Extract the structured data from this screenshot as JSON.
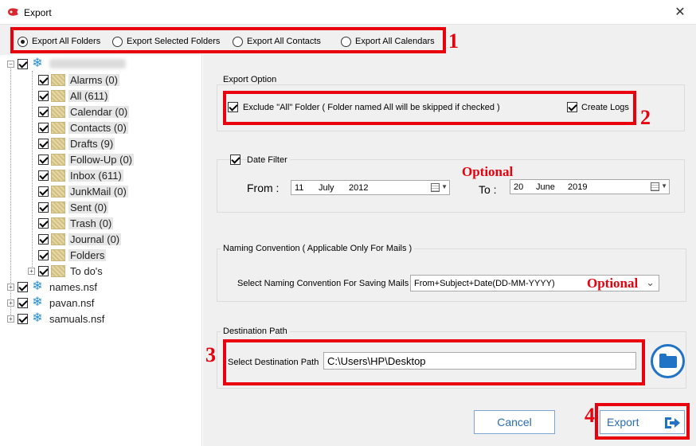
{
  "window": {
    "title": "Export",
    "close": "✕"
  },
  "radios": [
    {
      "label": "Export All Folders",
      "selected": true
    },
    {
      "label": "Export Selected Folders",
      "selected": false
    },
    {
      "label": "Export All Contacts",
      "selected": false
    },
    {
      "label": "Export All Calendars",
      "selected": false
    }
  ],
  "annotations": {
    "n1": "1",
    "n2": "2",
    "n3": "3",
    "n4": "4",
    "optional": "Optional"
  },
  "tree": {
    "children": [
      {
        "label": "Alarms (0)"
      },
      {
        "label": "All (611)"
      },
      {
        "label": "Calendar (0)"
      },
      {
        "label": "Contacts (0)"
      },
      {
        "label": "Drafts (9)"
      },
      {
        "label": "Follow-Up (0)"
      },
      {
        "label": "Inbox (611)"
      },
      {
        "label": "JunkMail (0)"
      },
      {
        "label": "Sent (0)"
      },
      {
        "label": "Trash (0)"
      },
      {
        "label": "Journal (0)"
      },
      {
        "label": "Folders"
      },
      {
        "label": "To do's"
      }
    ],
    "roots": [
      {
        "label": "names.nsf"
      },
      {
        "label": "pavan.nsf"
      },
      {
        "label": "samuals.nsf"
      }
    ]
  },
  "export_option": {
    "title": "Export Option",
    "exclude_label": "Exclude \"All\" Folder ( Folder named All will be skipped if checked )",
    "create_logs_label": "Create Logs"
  },
  "date_filter": {
    "label": "Date Filter",
    "from_label": "From :",
    "to_label": "To :",
    "from": {
      "day": "11",
      "month": "July",
      "year": "2012"
    },
    "to": {
      "day": "20",
      "month": "June",
      "year": "2019"
    }
  },
  "naming": {
    "title": "Naming Convention ( Applicable Only For Mails )",
    "select_label": "Select Naming Convention For Saving Mails",
    "selected": "From+Subject+Date(DD-MM-YYYY)"
  },
  "destination": {
    "title": "Destination Path",
    "label": "Select Destination Path",
    "value": "C:\\Users\\HP\\Desktop"
  },
  "buttons": {
    "cancel": "Cancel",
    "export": "Export"
  },
  "colors": {
    "annotation_red": "#e8000d",
    "accent_blue": "#2173c5"
  }
}
